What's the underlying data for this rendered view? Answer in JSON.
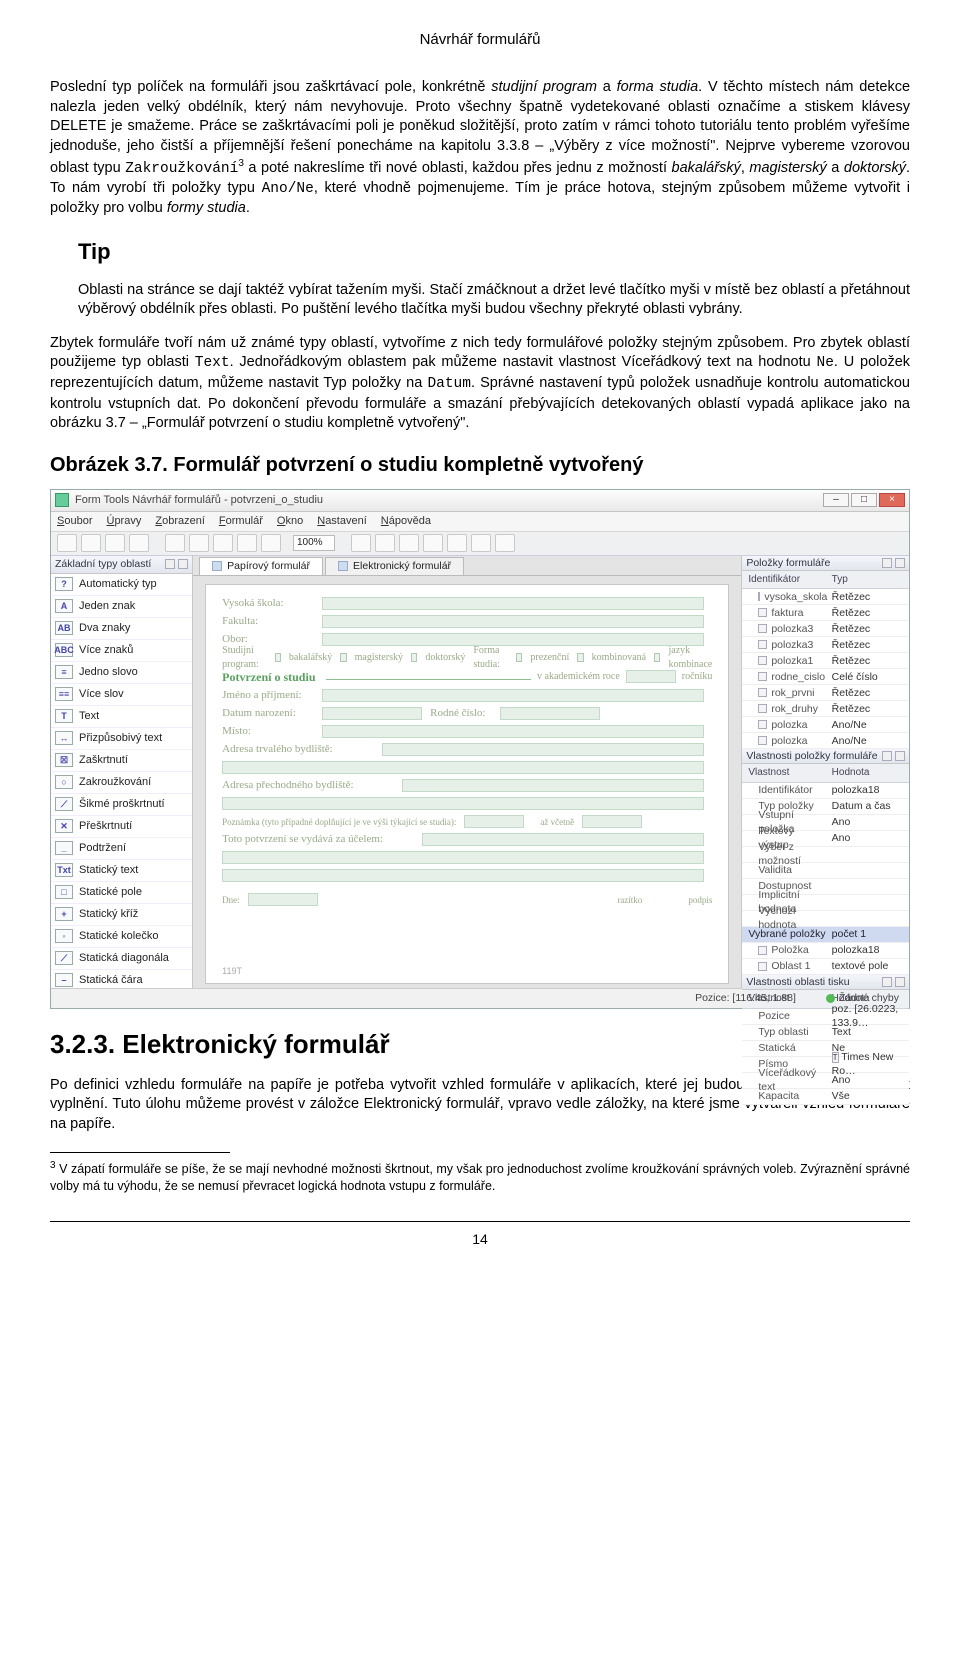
{
  "header": "Návrhář formulářů",
  "p1_before_italic1": "Poslední typ políček na formuláři jsou zaškrtávací pole, konkrétně ",
  "p1_italic1": "studijní program",
  "p1_mid1": " a ",
  "p1_italic2": "forma studia",
  "p1_after_italic2": ". V těchto místech nám detekce nalezla jeden velký obdélník, který nám nevyhovuje. Proto všechny špatně vydetekované oblasti označíme a stiskem klávesy DELETE je smažeme. Práce se zaškrtávacími poli je poněkud složitější, proto zatím v rámci tohoto tutoriálu tento problém vyřešíme jednoduše, jeho čistší a příjemnější řešení ponecháme na kapitolu 3.3.8 – „Výběry z více možností\". Nejprve vybereme vzorovou oblast typu ",
  "p1_code1": "Zakroužkování",
  "p1_fn": "3",
  "p1_after_code1": " a poté nakreslíme tři nové oblasti, každou přes jednu z možností ",
  "p1_italic3": "bakalářský",
  "p1_mid2": ", ",
  "p1_italic4": "magisterský",
  "p1_mid3": " a ",
  "p1_italic5": "doktorský",
  "p1_after_italic5": ". To nám vyrobí tři položky typu ",
  "p1_code2": "Ano/Ne",
  "p1_after_code2": ", které vhodně pojmenujeme. Tím je práce hotova, stejným způsobem můžeme vytvořit i položky pro volbu ",
  "p1_italic6": "formy studia",
  "p1_end": ".",
  "tip_head": "Tip",
  "tip_body": "Oblasti na stránce se dají taktéž vybírat tažením myši. Stačí zmáčknout a držet levé tlačítko myši v místě bez oblastí a přetáhnout výběrový obdélník přes oblasti. Po puštění levého tlačítka myši budou všechny překryté oblasti vybrány.",
  "p2_a": "Zbytek formuláře tvoří nám už známé typy oblastí, vytvoříme z nich tedy formulářové položky stejným způsobem. Pro zbytek oblastí použijeme typ oblasti ",
  "p2_code1": "Text",
  "p2_b": ". Jednořádkovým oblastem pak můžeme nastavit vlastnost Víceřádkový text na hodnotu ",
  "p2_code2": "Ne",
  "p2_c": ". U položek reprezentujících datum, můžeme nastavit Typ položky na ",
  "p2_code3": "Datum",
  "p2_d": ". Správné nastavení typů položek usnadňuje kontrolu automatickou kontrolu vstupních dat. Po dokončení převodu formuláře a smazání přebývajících detekovaných oblastí vypadá aplikace jako na obrázku 3.7 – „Formulář potvrzení o studiu kompletně vytvořený\".",
  "figcap": "Obrázek 3.7. Formulář potvrzení o studiu kompletně vytvořený",
  "h2": "3.2.3. Elektronický formulář",
  "p3": "Po definici vzhledu formuláře na papíře je potřeba vytvořit vzhled formuláře v aplikacích, které jej budou zobrazovat uživatelům k vyplnění. Tuto úlohu můžeme provést v záložce Elektronický formulář, vpravo vedle záložky, na které jsme vytvářeli vzhled formuláře na papíře.",
  "footnote_num": "3",
  "footnote": " V zápatí formuláře se píše, že se mají nevhodné možnosti škrtnout, my však pro jednoduchost zvolíme kroužkování správných voleb. Zvýraznění správné volby má tu výhodu, že se nemusí převracet logická hodnota vstupu z formuláře.",
  "pagenum": "14",
  "app": {
    "title": "Form Tools Návrhář formulářů - potvrzeni_o_studiu",
    "menu": [
      "Soubor",
      "Úpravy",
      "Zobrazení",
      "Formulář",
      "Okno",
      "Nastavení",
      "Nápověda"
    ],
    "zoom": "100%",
    "left_panel_title": "Základní typy oblastí",
    "types": [
      {
        "ic": "?",
        "t": "Automatický typ"
      },
      {
        "ic": "A",
        "t": "Jeden znak"
      },
      {
        "ic": "AB",
        "t": "Dva znaky"
      },
      {
        "ic": "ABC",
        "t": "Více znaků"
      },
      {
        "ic": "≡",
        "t": "Jedno slovo"
      },
      {
        "ic": "≡≡",
        "t": "Více slov"
      },
      {
        "ic": "T",
        "t": "Text"
      },
      {
        "ic": "↔",
        "t": "Přizpůsobivý text"
      },
      {
        "ic": "☒",
        "t": "Zaškrtnutí"
      },
      {
        "ic": "○",
        "t": "Zakroužkování"
      },
      {
        "ic": "⟋",
        "t": "Šikmé proškrtnutí"
      },
      {
        "ic": "✕",
        "t": "Přeškrtnutí"
      },
      {
        "ic": "_",
        "t": "Podtržení"
      },
      {
        "ic": "Txt",
        "t": "Statický text"
      },
      {
        "ic": "□",
        "t": "Statické pole"
      },
      {
        "ic": "+",
        "t": "Statický kříž"
      },
      {
        "ic": "◦",
        "t": "Statické kolečko"
      },
      {
        "ic": "⟋",
        "t": "Statická diagonála"
      },
      {
        "ic": "–",
        "t": "Statická čára"
      }
    ],
    "tabs": [
      {
        "label": "Papírový formulář",
        "active": true
      },
      {
        "label": "Elektronický formulář",
        "active": false
      }
    ],
    "form": {
      "r1": "Vysoká škola:",
      "r2": "Fakulta:",
      "r3": "Obor:",
      "prog": "Studijní program:",
      "p1": "bakalářský",
      "p2": "magisterský",
      "p3": "doktorský",
      "fs": "Forma studia:",
      "fs1": "prezenční",
      "fs2": "kombinovaná",
      "fs3": "jazyk kombinace",
      "title": "Potvrzení o studiu",
      "yrlbl": "v akademickém roce",
      "yrsep": "ročníku",
      "r4": "Jméno a příjmení:",
      "r5": "Datum narození:",
      "r6": "Rodné číslo:",
      "r7": "Místo:",
      "r8": "Adresa trvalého bydliště:",
      "r9": "Adresa přechodného bydliště:",
      "r10": "Poznámka (tyto případné doplňující je ve výši týkající se studia):",
      "r11": "až včetně",
      "r12": "Toto potvrzení se vydává za účelem:",
      "r13": "Dne:",
      "r14": "razítko",
      "r15": "podpis",
      "stamp": "119T"
    },
    "rp_items_title": "Položky formuláře",
    "rp_items_cols": [
      "Identifikátor",
      "Typ"
    ],
    "rp_items": [
      [
        "vysoka_skola",
        "Řetězec"
      ],
      [
        "faktura",
        "Řetězec"
      ],
      [
        "polozka3",
        "Řetězec"
      ],
      [
        "polozka3",
        "Řetězec"
      ],
      [
        "polozka1",
        "Řetězec"
      ],
      [
        "rodne_cislo",
        "Celé číslo"
      ],
      [
        "rok_prvni",
        "Řetězec"
      ],
      [
        "rok_druhy",
        "Řetězec"
      ],
      [
        "polozka",
        "Ano/Ne"
      ],
      [
        "polozka",
        "Ano/Ne"
      ]
    ],
    "rp_props_title": "Vlastnosti položky formuláře",
    "rp_props_cols": [
      "Vlastnost",
      "Hodnota"
    ],
    "rp_props": [
      [
        "Identifikátor",
        "polozka18"
      ],
      [
        "Typ položky",
        "Datum a čas"
      ],
      [
        "Vstupní položka",
        "Ano"
      ],
      [
        "Textový výstup",
        "Ano"
      ],
      [
        "Výběr z možností",
        ""
      ],
      [
        "Validita",
        ""
      ],
      [
        "Dostupnost",
        ""
      ],
      [
        "Implicitní hodnota",
        ""
      ],
      [
        "Výchozí hodnota",
        ""
      ]
    ],
    "rp_props_sel": [
      "Vybrané položky",
      "počet 1"
    ],
    "rp_props_sub": [
      [
        "Položka",
        "polozka18"
      ],
      [
        "Oblast 1",
        "textové pole"
      ]
    ],
    "rp_tisk_title": "Vlastnosti oblasti tisku",
    "rp_tisk_cols": [
      "Vlastnost",
      "Hodnota"
    ],
    "rp_tisk": [
      [
        "Pozice",
        "poz. [26.0223, 133.9…"
      ],
      [
        "Typ oblasti",
        "Text"
      ],
      [
        "Statická",
        "Ne"
      ],
      [
        "Písmo",
        "Times New Ro…"
      ],
      [
        "Víceřádkový text",
        "Ano"
      ],
      [
        "Kapacita",
        "Vše"
      ]
    ],
    "tisk_picon": "T",
    "status_pos": "Pozice: [116.45,  1.88]",
    "status_ok": "Žádné chyby"
  }
}
